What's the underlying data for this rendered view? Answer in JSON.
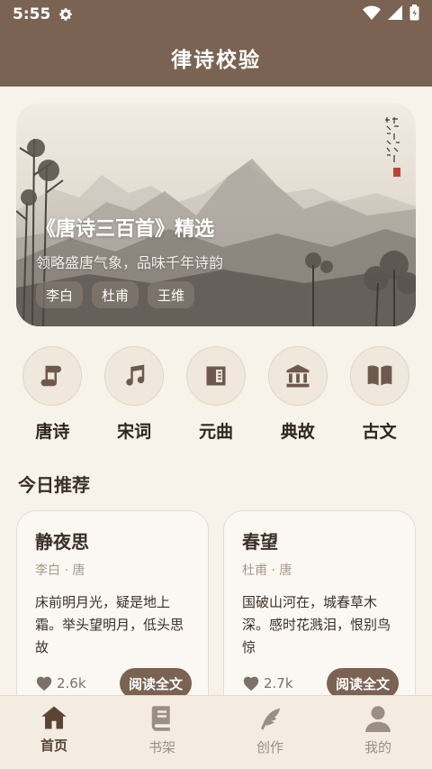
{
  "status_bar": {
    "time": "5:55"
  },
  "app_bar": {
    "title": "律诗校验"
  },
  "banner": {
    "title": "《唐诗三百首》精选",
    "subtitle": "领略盛唐气象，品味千年诗韵",
    "tags": [
      "李白",
      "杜甫",
      "王维"
    ]
  },
  "categories": [
    {
      "label": "唐诗",
      "icon": "scroll-icon"
    },
    {
      "label": "宋词",
      "icon": "music-note-icon"
    },
    {
      "label": "元曲",
      "icon": "book-page-icon"
    },
    {
      "label": "典故",
      "icon": "temple-icon"
    },
    {
      "label": "古文",
      "icon": "open-book-icon"
    }
  ],
  "section": {
    "title": "今日推荐"
  },
  "cards": [
    {
      "title": "静夜思",
      "author": "李白 · 唐",
      "text": "床前明月光，疑是地上霜。举头望明月，低头思故",
      "likes": "2.6k",
      "button": "阅读全文"
    },
    {
      "title": "春望",
      "author": "杜甫 · 唐",
      "text": "国破山河在，城春草木深。感时花溅泪，恨别鸟惊",
      "likes": "2.7k",
      "button": "阅读全文"
    }
  ],
  "bottom_nav": [
    {
      "label": "首页",
      "icon": "home-icon",
      "active": true
    },
    {
      "label": "书架",
      "icon": "bookshelf-icon",
      "active": false
    },
    {
      "label": "创作",
      "icon": "pen-icon",
      "active": false
    },
    {
      "label": "我的",
      "icon": "user-icon",
      "active": false
    }
  ],
  "colors": {
    "primary": "#7a6352",
    "background": "#f7f2ea",
    "card": "#fbf8f3"
  }
}
